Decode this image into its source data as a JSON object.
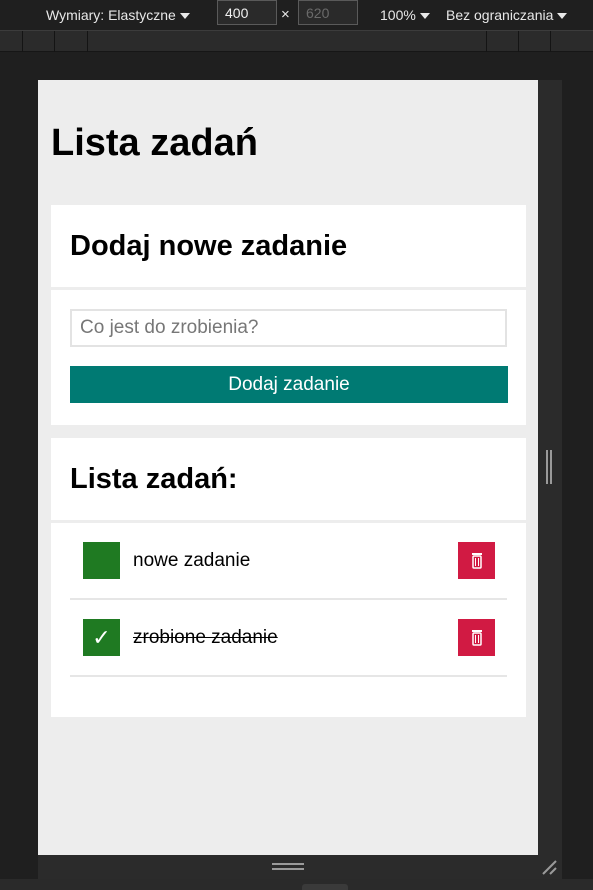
{
  "toolbar": {
    "dimensions_label": "Wymiary: Elastyczne",
    "width_value": "400",
    "height_value": "620",
    "times_symbol": "×",
    "zoom_label": "100%",
    "throttle_label": "Bez ograniczania"
  },
  "app": {
    "title": "Lista zadań",
    "add_section": {
      "heading": "Dodaj nowe zadanie",
      "input_placeholder": "Co jest do zrobienia?",
      "button_label": "Dodaj zadanie"
    },
    "list_section": {
      "heading": "Lista zadań:",
      "tasks": [
        {
          "label": "nowe zadanie",
          "done": false,
          "check_glyph": ""
        },
        {
          "label": "zrobione zadanie",
          "done": true,
          "check_glyph": "✓"
        }
      ]
    }
  },
  "icons": {
    "checkbox": "checkbox-icon",
    "trash": "trash-icon"
  },
  "colors": {
    "accent_teal": "#007a73",
    "checkbox_green": "#1f7a22",
    "delete_red": "#d11a43"
  }
}
